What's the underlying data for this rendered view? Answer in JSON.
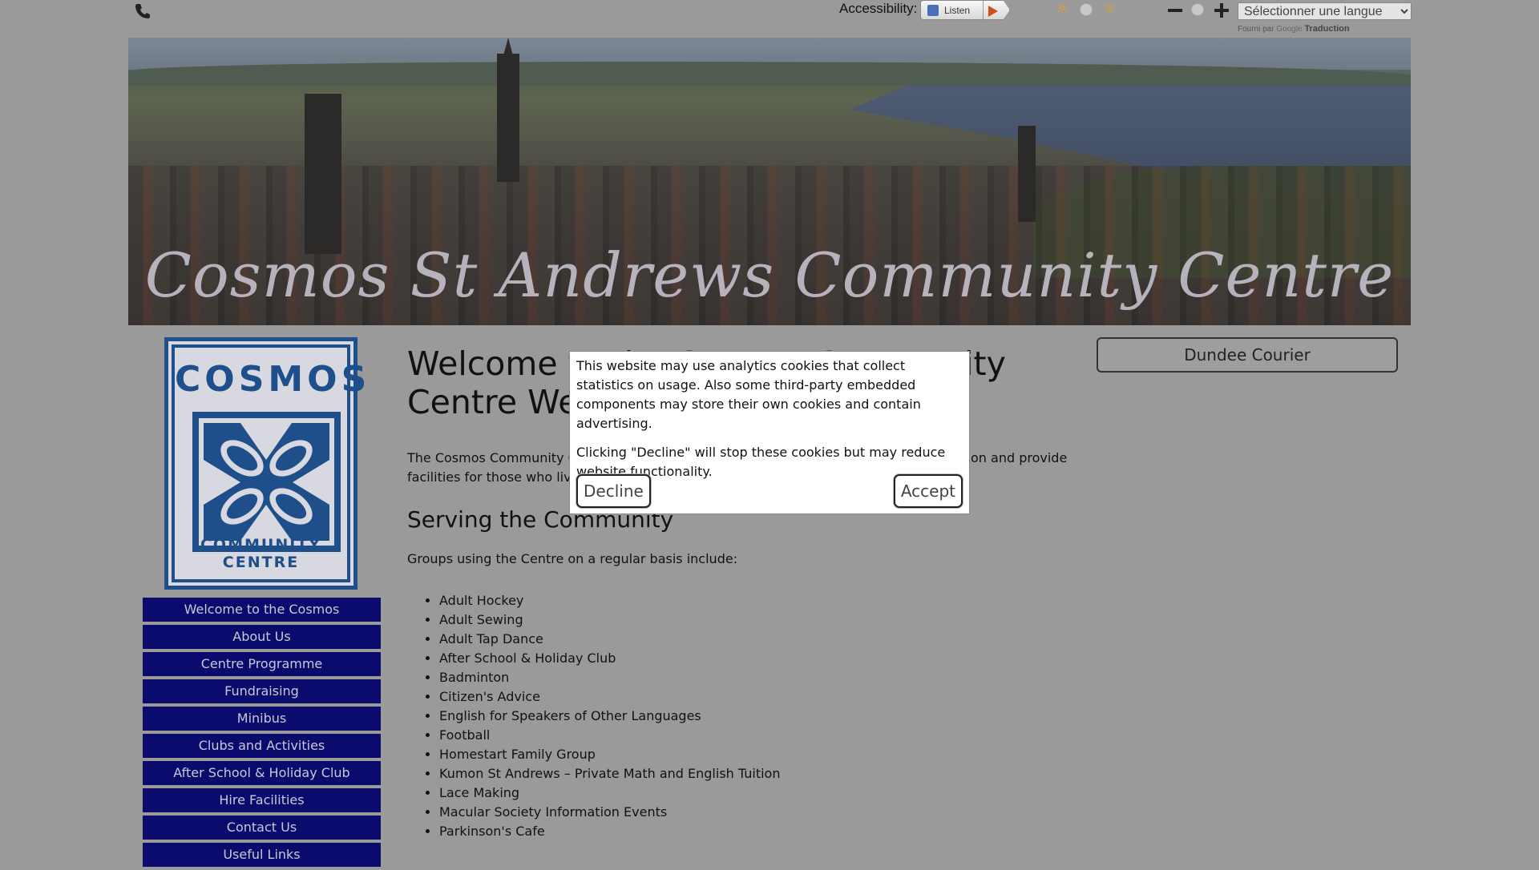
{
  "topbar": {
    "accessibility_label": "Accessibility:",
    "listen_label": "Listen",
    "language_select": "Sélectionner une langue",
    "powered_by": "Fourni par",
    "google": "Google",
    "translate": "Traduction"
  },
  "banner": {
    "title": "Cosmos St Andrews Community Centre"
  },
  "logo": {
    "top_text": "COSMOS",
    "bottom_text": "COMMUNITY CENTRE",
    "color": "#1e4f8a"
  },
  "nav": {
    "items": [
      "Welcome to the Cosmos",
      "About Us",
      "Centre Programme",
      "Fundraising",
      "Minibus",
      "Clubs and Activities",
      "After School & Holiday Club",
      "Hire Facilities",
      "Contact Us",
      "Useful Links"
    ],
    "background": "#0b0b6e"
  },
  "main": {
    "title": "Welcome to the Cosmos Community Centre Website",
    "intro": "The Cosmos Community Centre aims to support the local and wider community education and provide facilities for those who live, work and study in St Andrews and the surrounding areas.",
    "section_title": "Serving the Community",
    "groups_intro": "Groups using the Centre on a regular basis include:",
    "groups": [
      "Adult Hockey",
      "Adult Sewing",
      "Adult Tap Dance",
      "After School & Holiday Club",
      "Badminton",
      "Citizen's Advice",
      "English for Speakers of Other Languages",
      "Football",
      "Homestart Family Group",
      "Kumon St Andrews – Private Math and English Tuition",
      "Lace Making",
      "Macular Society Information Events",
      "Parkinson's Cafe"
    ]
  },
  "sidebar_right": {
    "news_button": "Dundee Courier"
  },
  "cookie": {
    "text1": "This website may use analytics cookies that collect statistics on usage. Also some third-party embedded components may store their own cookies and contain advertising.",
    "text2": "Clicking \"Decline\" will stop these cookies but may reduce website functionality.",
    "decline_label": "Decline",
    "accept_label": "Accept"
  },
  "icons": {
    "phone": "phone-icon",
    "speaker": "speaker-icon",
    "play": "play-icon",
    "contrast_light": "sun-icon",
    "contrast_dark": "sun-icon",
    "font_decrease": "minus-icon",
    "font_increase": "plus-icon"
  }
}
